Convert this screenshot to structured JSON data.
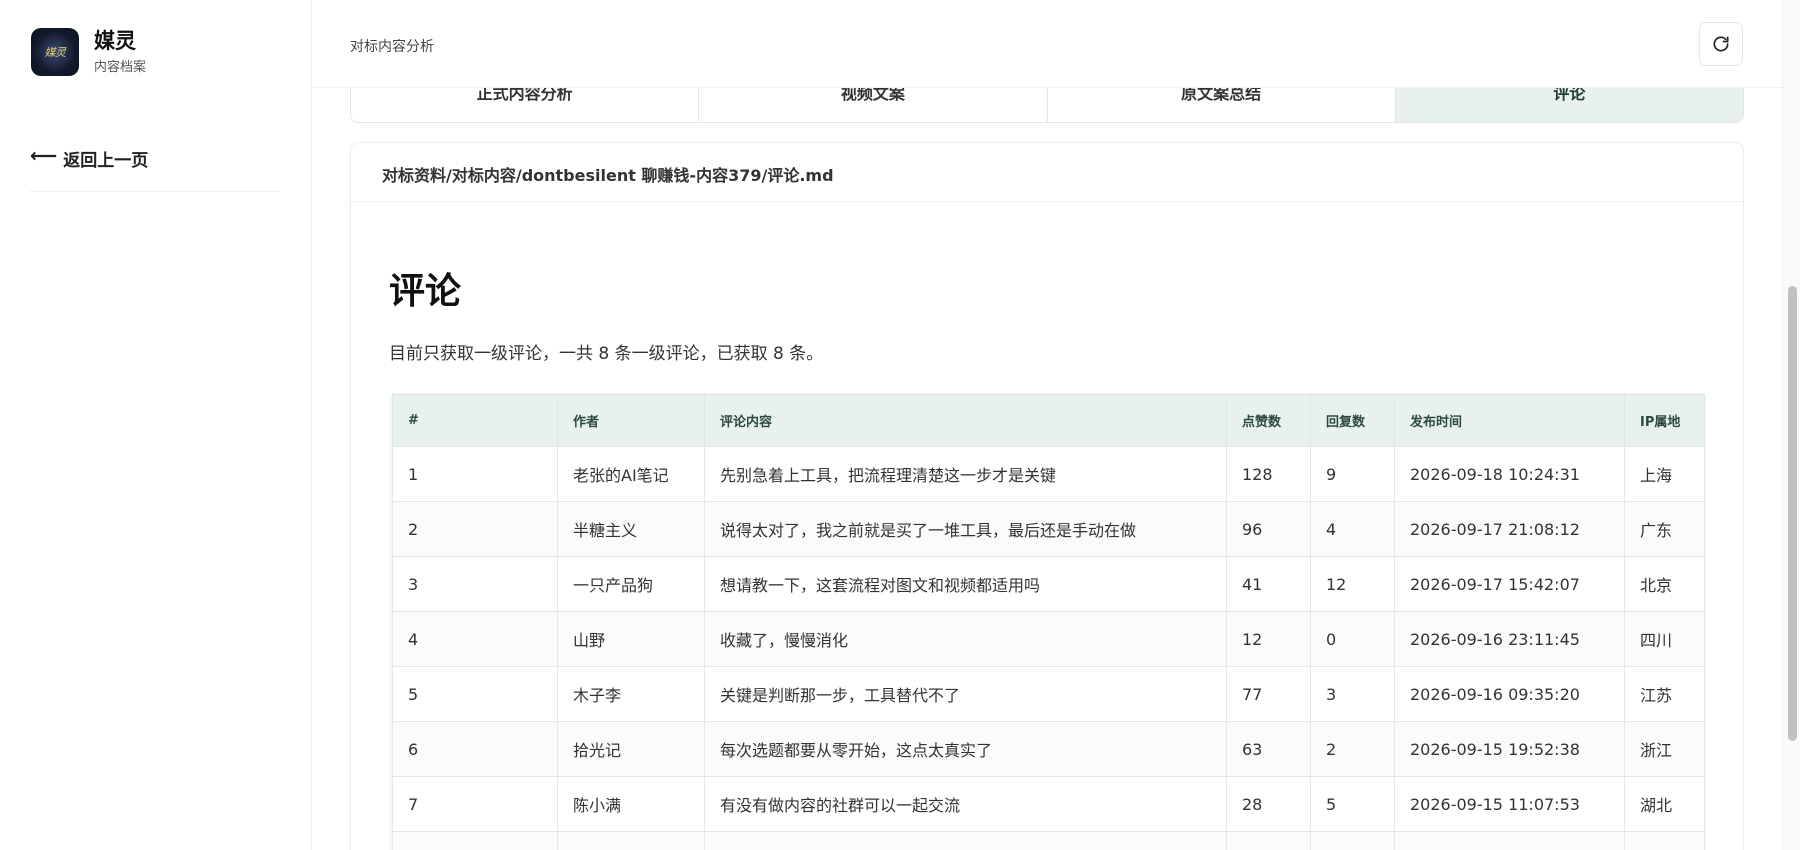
{
  "sidebar": {
    "brand_title": "媒灵",
    "brand_subtitle": "内容档案",
    "logo_text": "媒灵",
    "back_label": "返回上一页",
    "back_icon": "arrow-left-icon"
  },
  "header": {
    "title": "对标内容分析",
    "refresh_icon": "refresh-icon"
  },
  "tabs": [
    {
      "label": "正式内容分析",
      "active": false
    },
    {
      "label": "视频文案",
      "active": false
    },
    {
      "label": "原文案总结",
      "active": false
    },
    {
      "label": "评论",
      "active": true
    }
  ],
  "document": {
    "path": "对标资料/对标内容/dontbesilent 聊赚钱-内容379/评论.md",
    "title": "评论",
    "description": "目前只获取一级评论，一共 8 条一级评论，已获取 8 条。"
  },
  "table": {
    "headers": [
      "#",
      "作者",
      "评论内容",
      "点赞数",
      "回复数",
      "发布时间",
      "IP属地"
    ],
    "rows": [
      [
        "1",
        "老张的AI笔记",
        "先别急着上工具，把流程理清楚这一步才是关键",
        "128",
        "9",
        "2026-09-18 10:24:31",
        "上海"
      ],
      [
        "2",
        "半糖主义",
        "说得太对了，我之前就是买了一堆工具，最后还是手动在做",
        "96",
        "4",
        "2026-09-17 21:08:12",
        "广东"
      ],
      [
        "3",
        "一只产品狗",
        "想请教一下，这套流程对图文和视频都适用吗",
        "41",
        "12",
        "2026-09-17 15:42:07",
        "北京"
      ],
      [
        "4",
        "山野",
        "收藏了，慢慢消化",
        "12",
        "0",
        "2026-09-16 23:11:45",
        "四川"
      ],
      [
        "5",
        "木子李",
        "关键是判断那一步，工具替代不了",
        "77",
        "3",
        "2026-09-16 09:35:20",
        "江苏"
      ],
      [
        "6",
        "拾光记",
        "每次选题都要从零开始，这点太真实了",
        "63",
        "2",
        "2026-09-15 19:52:38",
        "浙江"
      ],
      [
        "7",
        "陈小满",
        "有没有做内容的社群可以一起交流",
        "28",
        "5",
        "2026-09-15 11:07:53",
        "湖北"
      ]
    ]
  },
  "colors": {
    "accent_bg": "#e9f1ee",
    "accent_text": "#2d4a40"
  }
}
